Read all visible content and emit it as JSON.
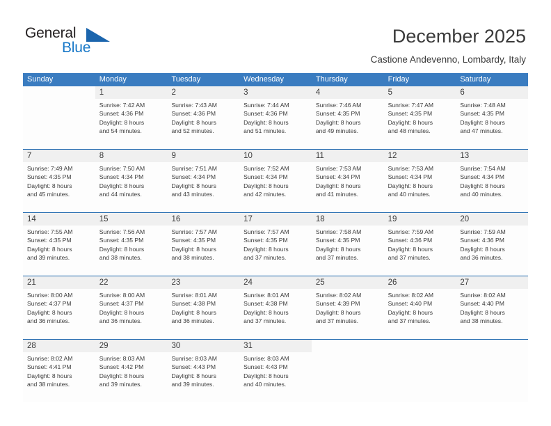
{
  "brand": {
    "name_part1": "General",
    "name_part2": "Blue",
    "triangle_icon": "triangle-logo-icon",
    "blue": "#1878c8",
    "dark_blue": "#1b65ad"
  },
  "header": {
    "title": "December 2025",
    "location": "Castione Andevenno, Lombardy, Italy"
  },
  "theme": {
    "header_bg": "#3a7cc0",
    "row_divider": "#1b65ad",
    "date_band_bg": "#f0f0f0",
    "cell_bg": "#fdfdfd",
    "text": "#3a3a3a"
  },
  "weekdays": [
    "Sunday",
    "Monday",
    "Tuesday",
    "Wednesday",
    "Thursday",
    "Friday",
    "Saturday"
  ],
  "weeks": [
    [
      {
        "day": "",
        "lines": []
      },
      {
        "day": "1",
        "lines": [
          "Sunrise: 7:42 AM",
          "Sunset: 4:36 PM",
          "Daylight: 8 hours",
          "and 54 minutes."
        ]
      },
      {
        "day": "2",
        "lines": [
          "Sunrise: 7:43 AM",
          "Sunset: 4:36 PM",
          "Daylight: 8 hours",
          "and 52 minutes."
        ]
      },
      {
        "day": "3",
        "lines": [
          "Sunrise: 7:44 AM",
          "Sunset: 4:36 PM",
          "Daylight: 8 hours",
          "and 51 minutes."
        ]
      },
      {
        "day": "4",
        "lines": [
          "Sunrise: 7:46 AM",
          "Sunset: 4:35 PM",
          "Daylight: 8 hours",
          "and 49 minutes."
        ]
      },
      {
        "day": "5",
        "lines": [
          "Sunrise: 7:47 AM",
          "Sunset: 4:35 PM",
          "Daylight: 8 hours",
          "and 48 minutes."
        ]
      },
      {
        "day": "6",
        "lines": [
          "Sunrise: 7:48 AM",
          "Sunset: 4:35 PM",
          "Daylight: 8 hours",
          "and 47 minutes."
        ]
      }
    ],
    [
      {
        "day": "7",
        "lines": [
          "Sunrise: 7:49 AM",
          "Sunset: 4:35 PM",
          "Daylight: 8 hours",
          "and 45 minutes."
        ]
      },
      {
        "day": "8",
        "lines": [
          "Sunrise: 7:50 AM",
          "Sunset: 4:34 PM",
          "Daylight: 8 hours",
          "and 44 minutes."
        ]
      },
      {
        "day": "9",
        "lines": [
          "Sunrise: 7:51 AM",
          "Sunset: 4:34 PM",
          "Daylight: 8 hours",
          "and 43 minutes."
        ]
      },
      {
        "day": "10",
        "lines": [
          "Sunrise: 7:52 AM",
          "Sunset: 4:34 PM",
          "Daylight: 8 hours",
          "and 42 minutes."
        ]
      },
      {
        "day": "11",
        "lines": [
          "Sunrise: 7:53 AM",
          "Sunset: 4:34 PM",
          "Daylight: 8 hours",
          "and 41 minutes."
        ]
      },
      {
        "day": "12",
        "lines": [
          "Sunrise: 7:53 AM",
          "Sunset: 4:34 PM",
          "Daylight: 8 hours",
          "and 40 minutes."
        ]
      },
      {
        "day": "13",
        "lines": [
          "Sunrise: 7:54 AM",
          "Sunset: 4:34 PM",
          "Daylight: 8 hours",
          "and 40 minutes."
        ]
      }
    ],
    [
      {
        "day": "14",
        "lines": [
          "Sunrise: 7:55 AM",
          "Sunset: 4:35 PM",
          "Daylight: 8 hours",
          "and 39 minutes."
        ]
      },
      {
        "day": "15",
        "lines": [
          "Sunrise: 7:56 AM",
          "Sunset: 4:35 PM",
          "Daylight: 8 hours",
          "and 38 minutes."
        ]
      },
      {
        "day": "16",
        "lines": [
          "Sunrise: 7:57 AM",
          "Sunset: 4:35 PM",
          "Daylight: 8 hours",
          "and 38 minutes."
        ]
      },
      {
        "day": "17",
        "lines": [
          "Sunrise: 7:57 AM",
          "Sunset: 4:35 PM",
          "Daylight: 8 hours",
          "and 37 minutes."
        ]
      },
      {
        "day": "18",
        "lines": [
          "Sunrise: 7:58 AM",
          "Sunset: 4:35 PM",
          "Daylight: 8 hours",
          "and 37 minutes."
        ]
      },
      {
        "day": "19",
        "lines": [
          "Sunrise: 7:59 AM",
          "Sunset: 4:36 PM",
          "Daylight: 8 hours",
          "and 37 minutes."
        ]
      },
      {
        "day": "20",
        "lines": [
          "Sunrise: 7:59 AM",
          "Sunset: 4:36 PM",
          "Daylight: 8 hours",
          "and 36 minutes."
        ]
      }
    ],
    [
      {
        "day": "21",
        "lines": [
          "Sunrise: 8:00 AM",
          "Sunset: 4:37 PM",
          "Daylight: 8 hours",
          "and 36 minutes."
        ]
      },
      {
        "day": "22",
        "lines": [
          "Sunrise: 8:00 AM",
          "Sunset: 4:37 PM",
          "Daylight: 8 hours",
          "and 36 minutes."
        ]
      },
      {
        "day": "23",
        "lines": [
          "Sunrise: 8:01 AM",
          "Sunset: 4:38 PM",
          "Daylight: 8 hours",
          "and 36 minutes."
        ]
      },
      {
        "day": "24",
        "lines": [
          "Sunrise: 8:01 AM",
          "Sunset: 4:38 PM",
          "Daylight: 8 hours",
          "and 37 minutes."
        ]
      },
      {
        "day": "25",
        "lines": [
          "Sunrise: 8:02 AM",
          "Sunset: 4:39 PM",
          "Daylight: 8 hours",
          "and 37 minutes."
        ]
      },
      {
        "day": "26",
        "lines": [
          "Sunrise: 8:02 AM",
          "Sunset: 4:40 PM",
          "Daylight: 8 hours",
          "and 37 minutes."
        ]
      },
      {
        "day": "27",
        "lines": [
          "Sunrise: 8:02 AM",
          "Sunset: 4:40 PM",
          "Daylight: 8 hours",
          "and 38 minutes."
        ]
      }
    ],
    [
      {
        "day": "28",
        "lines": [
          "Sunrise: 8:02 AM",
          "Sunset: 4:41 PM",
          "Daylight: 8 hours",
          "and 38 minutes."
        ]
      },
      {
        "day": "29",
        "lines": [
          "Sunrise: 8:03 AM",
          "Sunset: 4:42 PM",
          "Daylight: 8 hours",
          "and 39 minutes."
        ]
      },
      {
        "day": "30",
        "lines": [
          "Sunrise: 8:03 AM",
          "Sunset: 4:43 PM",
          "Daylight: 8 hours",
          "and 39 minutes."
        ]
      },
      {
        "day": "31",
        "lines": [
          "Sunrise: 8:03 AM",
          "Sunset: 4:43 PM",
          "Daylight: 8 hours",
          "and 40 minutes."
        ]
      },
      {
        "day": "",
        "lines": []
      },
      {
        "day": "",
        "lines": []
      },
      {
        "day": "",
        "lines": []
      }
    ]
  ]
}
